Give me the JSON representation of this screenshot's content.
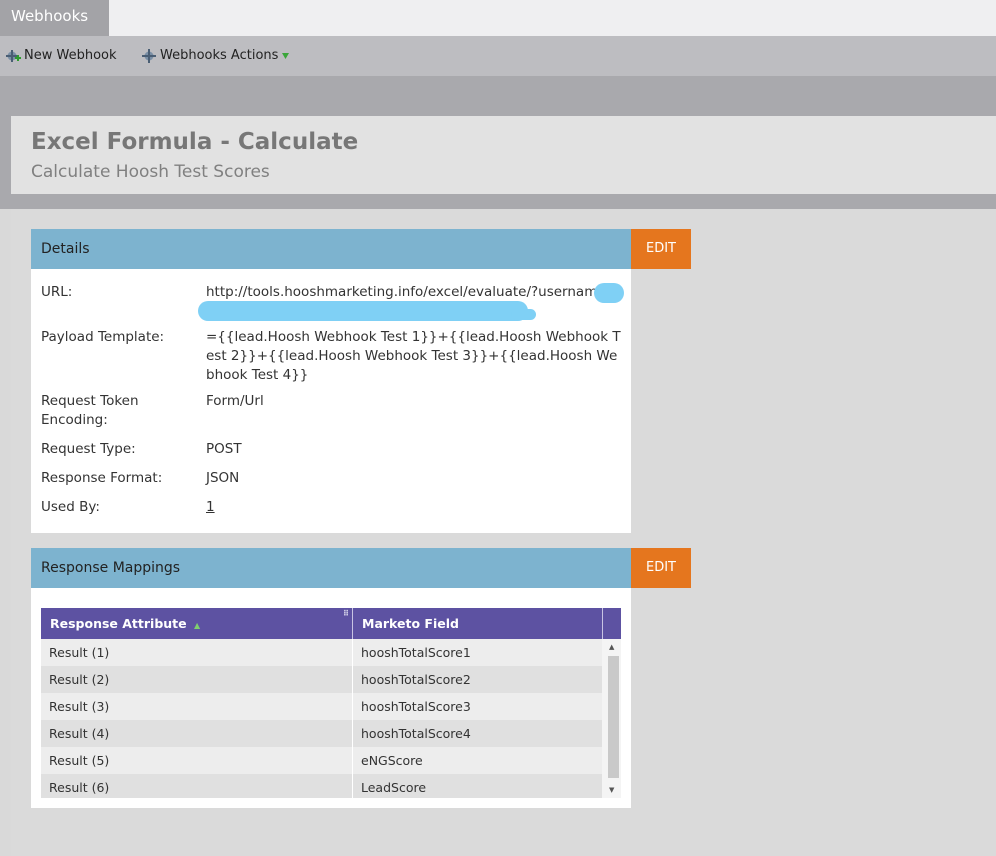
{
  "tabs": {
    "active": "Webhooks"
  },
  "toolbar": {
    "new_webhook": "New Webhook",
    "actions": "Webhooks Actions"
  },
  "page": {
    "title": "Excel Formula - Calculate",
    "subtitle": "Calculate Hoosh Test Scores"
  },
  "details": {
    "heading": "Details",
    "edit": "EDIT",
    "url_label": "URL:",
    "url_value": "http://tools.hooshmarketing.info/excel/evaluate/?username=",
    "payload_label": "Payload Template:",
    "payload_value": "={{lead.Hoosh Webhook Test 1}}+{{lead.Hoosh Webhook Test 2}}+{{lead.Hoosh Webhook Test 3}}+{{lead.Hoosh Webhook Test 4}}",
    "encoding_label": "Request Token Encoding:",
    "encoding_value": "Form/Url",
    "type_label": "Request Type:",
    "type_value": "POST",
    "format_label": "Response Format:",
    "format_value": "JSON",
    "used_label": "Used By:",
    "used_value": "1"
  },
  "mappings": {
    "heading": "Response Mappings",
    "edit": "EDIT",
    "col_attribute": "Response Attribute",
    "col_field": "Marketo Field",
    "rows": [
      {
        "attribute": "Result (1)",
        "field": "hooshTotalScore1"
      },
      {
        "attribute": "Result (2)",
        "field": "hooshTotalScore2"
      },
      {
        "attribute": "Result (3)",
        "field": "hooshTotalScore3"
      },
      {
        "attribute": "Result (4)",
        "field": "hooshTotalScore4"
      },
      {
        "attribute": "Result (5)",
        "field": "eNGScore"
      },
      {
        "attribute": "Result (6)",
        "field": "LeadScore"
      }
    ]
  },
  "colors": {
    "section_header": "#7db3cf",
    "edit_button": "#e5761e",
    "grid_header": "#5d52a2"
  }
}
